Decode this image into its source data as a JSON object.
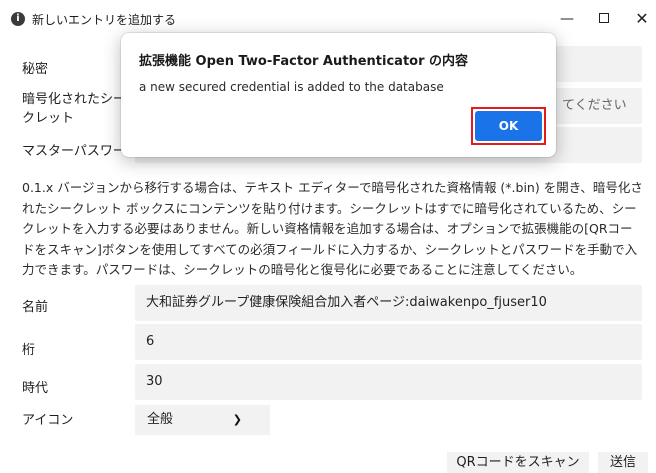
{
  "window": {
    "title": "新しいエントリを追加する",
    "icon": "info-circle-icon",
    "controls": {
      "minimize": "—",
      "maximize": "maximize-icon",
      "close": "✕"
    }
  },
  "form": {
    "secret": {
      "label": "秘密",
      "value": ""
    },
    "encrypted_secret": {
      "label": "暗号化されたシークレット",
      "placeholder": "てください"
    },
    "master_password": {
      "label": "マスターパスワー",
      "value": ""
    },
    "info_text": "0.1.x バージョンから移行する場合は、テキスト エディターで暗号化された資格情報 (*.bin) を開き、暗号化されたシークレット ボックスにコンテンツを貼り付けます。シークレットはすでに暗号化されているため、シークレットを入力する必要はありません。新しい資格情報を追加する場合は、オプションで拡張機能の[QRコードをスキャン]ボタンを使用してすべての必須フィールドに入力するか、シークレットとパスワードを手動で入力できます。パスワードは、シークレットの暗号化と復号化に必要であることに注意してください。",
    "name": {
      "label": "名前",
      "value": "大和証券グループ健康保険組合加入者ページ:daiwakenpo_fjuser10"
    },
    "digits": {
      "label": "桁",
      "value": "6"
    },
    "period": {
      "label": "時代",
      "value": "30"
    },
    "icon": {
      "label": "アイコン",
      "selected": "全般"
    },
    "scan_button": "QRコードをスキャン",
    "send_button": "送信"
  },
  "dialog": {
    "title": "拡張機能 Open Two-Factor Authenticator の内容",
    "message": "a new secured credential is added to the database",
    "ok_button": "OK",
    "ok_button_color": "#1a73e8",
    "highlight_color": "#e01c1c"
  }
}
